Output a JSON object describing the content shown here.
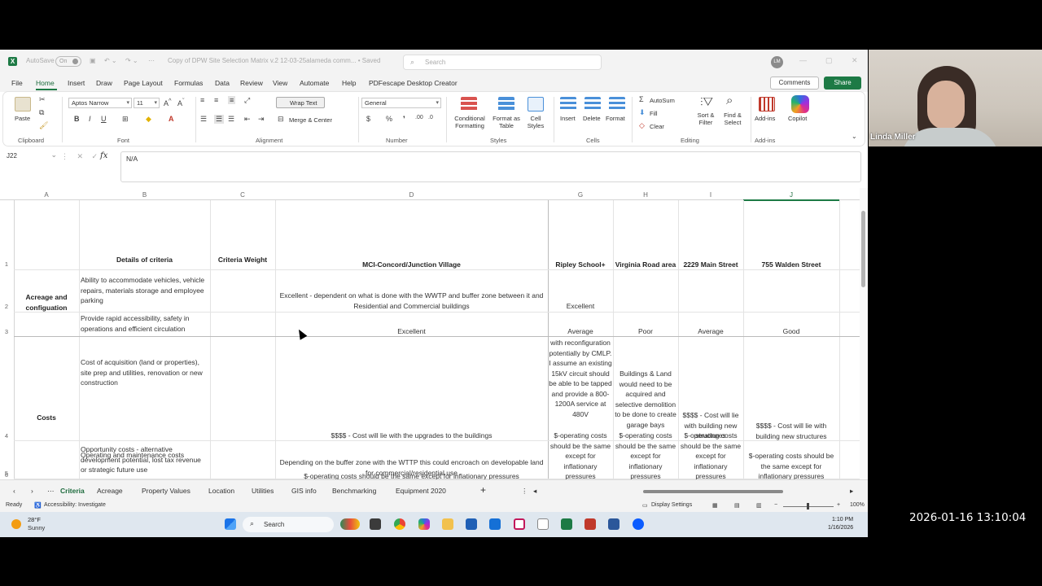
{
  "titlebar": {
    "autosave_label": "AutoSave",
    "autosave_state": "On",
    "doc_title": "Copy of DPW Site Selection Matrix v.2 12-03-25alameda comm... • Saved",
    "search_placeholder": "Search",
    "user_initials": "LM"
  },
  "menu": {
    "tabs": [
      "File",
      "Home",
      "Insert",
      "Draw",
      "Page Layout",
      "Formulas",
      "Data",
      "Review",
      "View",
      "Automate",
      "Help",
      "PDFescape Desktop Creator"
    ],
    "comments_label": "Comments",
    "share_label": "Share"
  },
  "ribbon": {
    "paste_label": "Paste",
    "clipboard_label": "Clipboard",
    "font_name": "Aptos Narrow",
    "font_size": "11",
    "font_label": "Font",
    "wrap_text_label": "Wrap Text",
    "merge_center_label": "Merge & Center",
    "alignment_label": "Alignment",
    "number_format": "General",
    "number_label": "Number",
    "conditional_formatting_label": "Conditional Formatting",
    "format_as_table_label": "Format as Table",
    "cell_styles_label": "Cell Styles",
    "styles_label": "Styles",
    "insert_label": "Insert",
    "delete_label": "Delete",
    "format_label": "Format",
    "cells_label": "Cells",
    "autosum_label": "AutoSum",
    "fill_label": "Fill",
    "clear_label": "Clear",
    "sort_filter_label": "Sort & Filter",
    "find_select_label": "Find & Select",
    "editing_label": "Editing",
    "addins_label": "Add-ins",
    "addins_group_label": "Add-ins",
    "copilot_label": "Copilot"
  },
  "formula_bar": {
    "name_box": "J22",
    "formula": "N/A"
  },
  "grid": {
    "col_letters": [
      "A",
      "B",
      "C",
      "D",
      "G",
      "H",
      "I",
      "J"
    ],
    "row_numbers": [
      "1",
      "2",
      "3",
      "4",
      "5",
      "6"
    ],
    "header": {
      "b": "Details of criteria",
      "c": "Criteria Weight",
      "d": "MCI-Concord/Junction Village",
      "g": "Ripley School+",
      "h": "Virginia Road area",
      "i": "2229 Main Street",
      "j": "755 Walden Street"
    },
    "r2": {
      "a": "Acreage and configuation",
      "b": "Ability to accommodate vehicles, vehicle repairs, materials storage and employee parking",
      "d": "Excellent - dependent on what is done with the WWTP and buffer zone between it and Residential and Commercial buildings",
      "g": "Excellent"
    },
    "r3": {
      "b": "Provide rapid accessibility, safety in operations and efficient circulation",
      "d": "Excellent",
      "g": "Average",
      "h": "Poor",
      "i": "Average",
      "j": "Good"
    },
    "r4": {
      "a": "Costs",
      "b": "Cost of acquisition (land or properties), site prep and utilities, renovation or  new construction",
      "d": "$$$$ - Cost will lie with the upgrades to the buildings",
      "g": "with reconfiguration potentially by CMLP. I assume an existing 15kV circuit should be able to be tapped and provide a 800-1200A service at 480V",
      "h": "Buildings & Land would need to be acquired and selective demolition to be done to create garage bays",
      "i": "$$$$ - Cost will lie with building new structures",
      "j": "$$$$ - Cost will lie with building new structures"
    },
    "r5": {
      "b": "Opportunity costs - alternative development potential, lost tax revenue or strategic future use",
      "d": "Depending on the buffer zone with the WTTP this could encroach on developable land for commercial/residential use"
    },
    "r6": {
      "b": "Operating and maintenance costs",
      "d": "$-operating costs should be the same except for inflationary pressures",
      "g": "$-operating costs should be the same except for inflationary pressures",
      "h": "$-operating costs should be the same except for inflationary pressures",
      "i": "$-operating costs should be the same except for inflationary pressures",
      "j": "$-operating costs should be the same except for inflationary pressures"
    }
  },
  "sheets": {
    "tabs": [
      "Criteria",
      "Acreage",
      "Property Values",
      "Location",
      "Utilities",
      "GIS info",
      "Benchmarking",
      "Equipment 2020"
    ],
    "active": "Criteria"
  },
  "status": {
    "ready": "Ready",
    "accessibility": "Accessibility: Investigate",
    "display_settings": "Display Settings",
    "zoom": "100%"
  },
  "taskbar": {
    "temperature": "28°F",
    "condition": "Sunny",
    "search_label": "Search",
    "time": "1:10 PM",
    "date": "1/16/2026"
  },
  "video": {
    "participant_name": "Linda Miller"
  },
  "overlay_timestamp": "2026-01-16 13:10:04",
  "colors": {
    "excel_green": "#1d7a45",
    "chrome_gray": "#f3f3f3"
  }
}
